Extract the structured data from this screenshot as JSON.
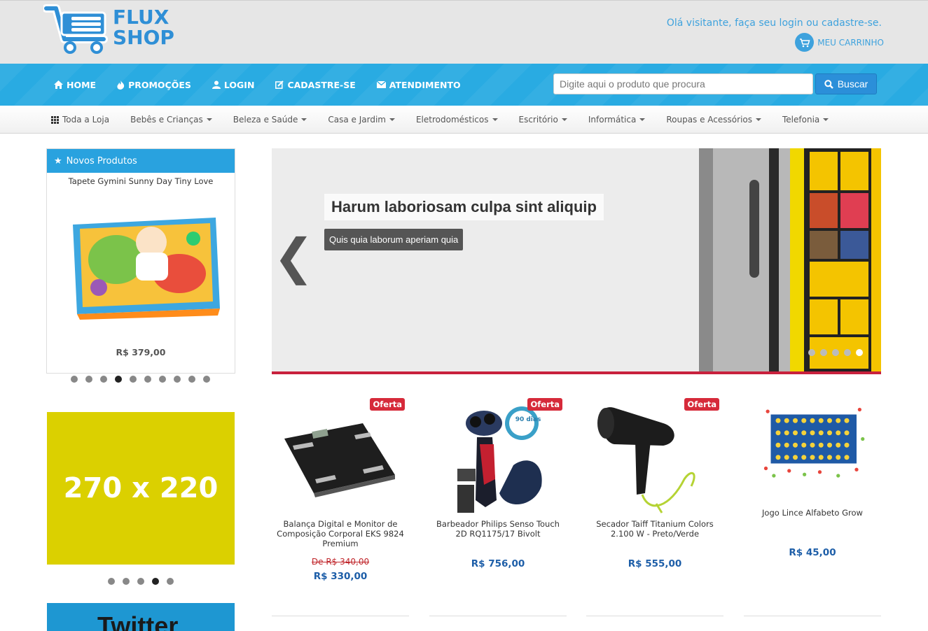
{
  "header": {
    "logo_line1": "FLUX",
    "logo_line2": "SHOP",
    "welcome": "Olá visitante, faça seu login ou cadastre-se.",
    "cart_label": "MEU CARRINHO"
  },
  "nav": {
    "items": [
      {
        "label": "HOME",
        "icon": "home-icon"
      },
      {
        "label": "PROMOÇÕES",
        "icon": "fire-icon"
      },
      {
        "label": "LOGIN",
        "icon": "user-icon"
      },
      {
        "label": "CADASTRE-SE",
        "icon": "edit-icon"
      },
      {
        "label": "ATENDIMENTO",
        "icon": "envelope-icon"
      }
    ],
    "search_placeholder": "Digite aqui o produto que procura",
    "search_button": "Buscar"
  },
  "categories": [
    {
      "label": "Toda a Loja"
    },
    {
      "label": "Bebês e Crianças"
    },
    {
      "label": "Beleza e Saúde"
    },
    {
      "label": "Casa e Jardim"
    },
    {
      "label": "Eletrodomésticos"
    },
    {
      "label": "Escritório"
    },
    {
      "label": "Informática"
    },
    {
      "label": "Roupas e Acessórios"
    },
    {
      "label": "Telefonia"
    }
  ],
  "sidebar": {
    "novos_title": "Novos Produtos",
    "product_name": "Tapete Gymini Sunny Day Tiny Love",
    "product_price": "R$ 379,00",
    "carousel_active": 4,
    "carousel_count": 10,
    "ad_label": "270 x 220",
    "ad_active": 4,
    "ad_count": 5,
    "twitter_label": "Twitter"
  },
  "slider": {
    "title": "Harum laboriosam culpa sint aliquip",
    "subtitle": "Quis quia laborum aperiam quia",
    "prev_arrow": "❮",
    "slide_count": 5,
    "active_slide": 5
  },
  "products": [
    {
      "name": "Balança Digital e Monitor de Composição Corporal EKS 9824 Premium",
      "badge": "Oferta",
      "old_price": "De R$ 340,00",
      "price": "R$ 330,00"
    },
    {
      "name": "Barbeador Philips Senso Touch 2D RQ1175/17 Bivolt",
      "badge": "Oferta",
      "old_price": "",
      "price": "R$ 756,00",
      "seal": "90 dias"
    },
    {
      "name": "Secador Taiff Titanium Colors 2.100 W - Preto/Verde",
      "badge": "Oferta",
      "old_price": "",
      "price": "R$ 555,00"
    },
    {
      "name": "Jogo Lince Alfabeto Grow",
      "badge": "",
      "old_price": "",
      "price": "R$ 45,00"
    }
  ],
  "colors": {
    "brand_blue": "#29abe2",
    "accent_red": "#c8213d",
    "price_blue": "#1d5ea8"
  }
}
